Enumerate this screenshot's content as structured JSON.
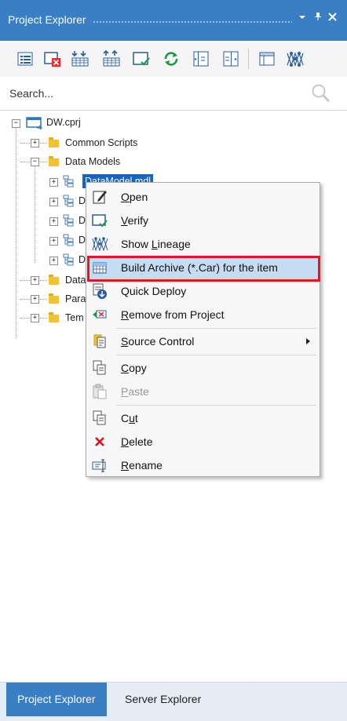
{
  "panel": {
    "title": "Project Explorer",
    "pin_glyph": "⇣",
    "pin2_glyph": "‖",
    "close_glyph": "✕"
  },
  "toolbar": {
    "icons": [
      "properties-icon",
      "delete-item-icon",
      "import-icon",
      "export-icon",
      "verify-icon",
      "refresh-icon",
      "collapse-icon",
      "expand-icon",
      "layout-icon",
      "lineage-icon"
    ]
  },
  "search": {
    "placeholder": "Search..."
  },
  "tree": {
    "root": "DW.cprj",
    "common_scripts": "Common Scripts",
    "data_models": "Data Models",
    "selected_item": "DataModel.mdl",
    "child_initials": [
      "D",
      "D",
      "D",
      "D"
    ],
    "folder_data": "Data",
    "folder_para": "Para",
    "folder_tem": "Tem"
  },
  "context_menu": {
    "items": [
      {
        "label": "Open",
        "mn": "O",
        "rest": "pen",
        "icon": "open-icon"
      },
      {
        "label": "Verify",
        "mn": "V",
        "rest": "erify",
        "icon": "verify-icon"
      },
      {
        "label": "Show Lineage",
        "pre": "Show ",
        "mn": "L",
        "rest": "ineage",
        "icon": "lineage-icon"
      },
      {
        "label": "Build Archive (*.Car) for the item",
        "icon": "archive-icon"
      },
      {
        "label": "Quick Deploy",
        "icon": "deploy-icon"
      },
      {
        "label": "Remove from Project",
        "mn": "R",
        "rest": "emove from Project",
        "icon": "remove-icon"
      },
      {
        "label": "Source Control",
        "mn": "S",
        "rest": "ource Control",
        "icon": "source-control-icon"
      },
      {
        "label": "Copy",
        "mn": "C",
        "rest": "opy",
        "icon": "copy-icon"
      },
      {
        "label": "Paste",
        "mn": "P",
        "rest": "aste",
        "icon": "paste-icon"
      },
      {
        "label": "Cut",
        "pre": "C",
        "mn": "u",
        "rest": "t",
        "icon": "cut-icon"
      },
      {
        "label": "Delete",
        "mn": "D",
        "rest": "elete",
        "icon": "delete-icon"
      },
      {
        "label": "Rename",
        "mn": "R",
        "rest": "ename",
        "icon": "rename-icon"
      }
    ]
  },
  "tabs": {
    "project_explorer": "Project Explorer",
    "server_explorer": "Server Explorer"
  },
  "colors": {
    "accent": "#3a7ec4",
    "highlight_border": "#e8141f",
    "selection": "#1565c0"
  }
}
